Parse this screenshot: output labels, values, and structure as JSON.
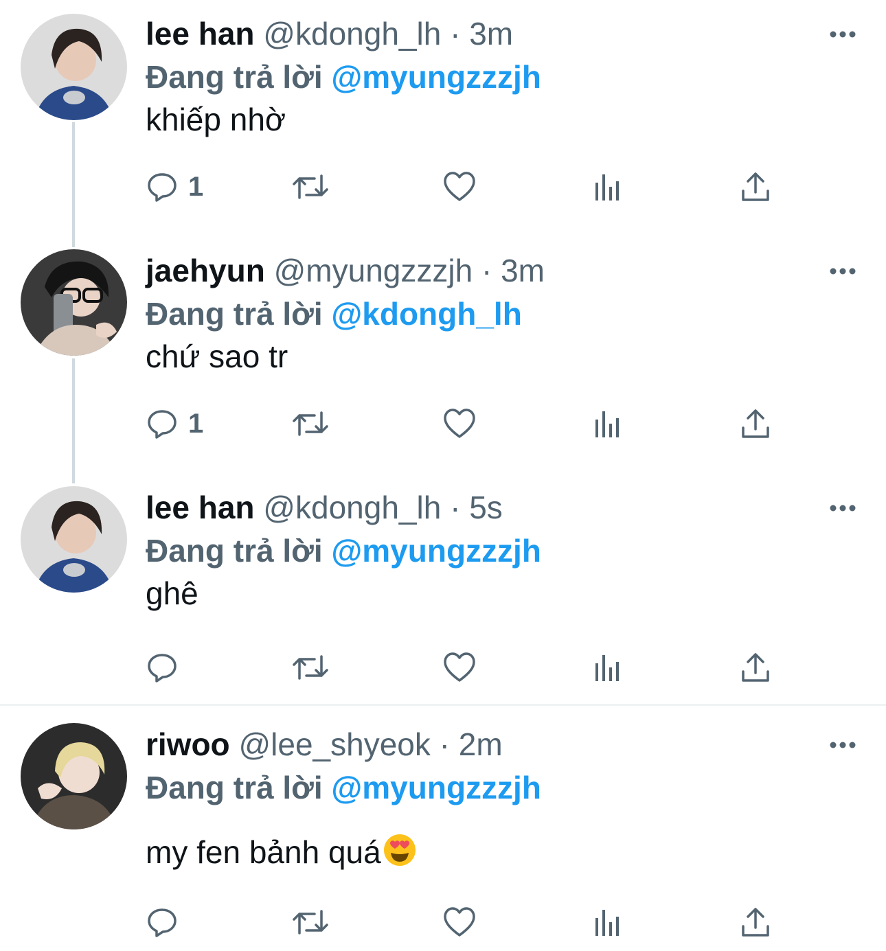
{
  "colors": {
    "accent": "#1d9bf0",
    "secondary": "#536471",
    "text": "#0f1419",
    "line": "#cfd9de"
  },
  "tweets": [
    {
      "name": "lee han",
      "handle": "@kdongh_lh",
      "sep": "·",
      "time": "3m",
      "reply_label": "Đang trả lời",
      "reply_to": "@myungzzzjh",
      "text": "khiếp nhờ",
      "reply_count": "1",
      "avatar": "avatar-lee-han"
    },
    {
      "name": "jaehyun",
      "handle": "@myungzzzjh",
      "sep": "·",
      "time": "3m",
      "reply_label": "Đang trả lời",
      "reply_to": "@kdongh_lh",
      "text": "chứ sao tr",
      "reply_count": "1",
      "avatar": "avatar-jaehyun"
    },
    {
      "name": "lee han",
      "handle": "@kdongh_lh",
      "sep": "·",
      "time": "5s",
      "reply_label": "Đang trả lời",
      "reply_to": "@myungzzzjh",
      "text": "ghê",
      "reply_count": "",
      "avatar": "avatar-lee-han"
    },
    {
      "name": "riwoo",
      "handle": "@lee_shyeok",
      "sep": "·",
      "time": "2m",
      "reply_label": "Đang trả lời",
      "reply_to": "@myungzzzjh",
      "text": "my fen bảnh quá",
      "emoji": "😍",
      "reply_count": "",
      "avatar": "avatar-riwoo"
    }
  ],
  "icons": {
    "reply": "reply-bubble-icon",
    "retweet": "retweet-icon",
    "like": "heart-icon",
    "views": "analytics-bars-icon",
    "share": "share-upload-icon",
    "more": "more-dots-icon"
  }
}
